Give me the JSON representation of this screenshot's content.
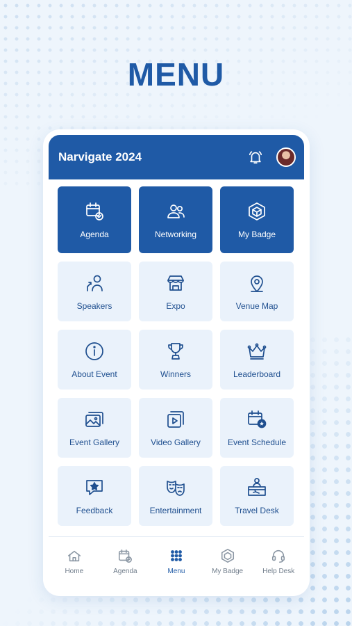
{
  "headline": "MENU",
  "app": {
    "title": "Narvigate 2024",
    "icons": {
      "bell": "bell-icon",
      "avatar": "user-avatar"
    }
  },
  "tiles": [
    {
      "label": "Agenda",
      "icon": "calendar-check-icon",
      "primary": true
    },
    {
      "label": "Networking",
      "icon": "people-icon",
      "primary": true
    },
    {
      "label": "My Badge",
      "icon": "badge-cube-icon",
      "primary": true
    },
    {
      "label": "Speakers",
      "icon": "speaker-icon"
    },
    {
      "label": "Expo",
      "icon": "booth-icon"
    },
    {
      "label": "Venue Map",
      "icon": "map-pin-icon"
    },
    {
      "label": "About Event",
      "icon": "info-icon"
    },
    {
      "label": "Winners",
      "icon": "trophy-icon"
    },
    {
      "label": "Leaderboard",
      "icon": "crown-icon"
    },
    {
      "label": "Event Gallery",
      "icon": "gallery-icon"
    },
    {
      "label": "Video Gallery",
      "icon": "video-icon"
    },
    {
      "label": "Event Schedule",
      "icon": "calendar-star-icon"
    },
    {
      "label": "Feedback",
      "icon": "feedback-star-icon"
    },
    {
      "label": "Entertainment",
      "icon": "theatre-masks-icon"
    },
    {
      "label": "Travel Desk",
      "icon": "travel-desk-icon"
    }
  ],
  "nav": [
    {
      "label": "Home",
      "icon": "home-icon"
    },
    {
      "label": "Agenda",
      "icon": "calendar-check-icon"
    },
    {
      "label": "Menu",
      "icon": "grid-dots-icon",
      "active": true
    },
    {
      "label": "My Badge",
      "icon": "badge-cube-icon"
    },
    {
      "label": "Help Desk",
      "icon": "headset-icon"
    }
  ],
  "colors": {
    "brand": "#1f5aa6",
    "tile_bg": "#eaf2fb",
    "nav_text": "#6f7c8a"
  }
}
